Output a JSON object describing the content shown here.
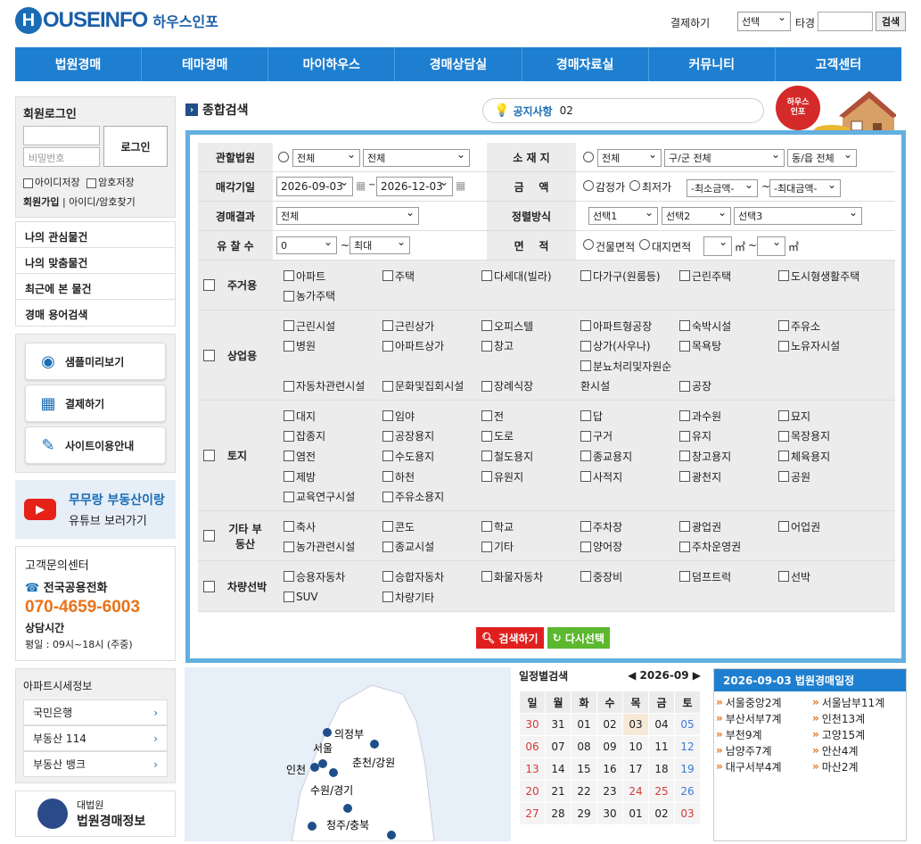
{
  "header": {
    "logo_letter": "H",
    "logo_text": "OUSEINFO",
    "logo_kr": "하우스인포",
    "pay": "결제하기",
    "select": "선택",
    "other": "타경",
    "search": "검색"
  },
  "nav": [
    "법원경매",
    "테마경매",
    "마이하우스",
    "경매상담실",
    "경매자료실",
    "커뮤니티",
    "고객센터"
  ],
  "login": {
    "title": "회원로그인",
    "pw": "비밀번호",
    "btn": "로그인",
    "save_id": "아이디저장",
    "save_pw": "암호저장",
    "join": "회원가입",
    "find": "아이디/암호찾기"
  },
  "menu": [
    "나의 관심물건",
    "나의 맞춤물건",
    "최근에 본 물건",
    "경매 용어검색"
  ],
  "quick": [
    {
      "icon": "eye-icon",
      "label": "샘플미리보기"
    },
    {
      "icon": "payment-icon",
      "label": "결제하기"
    },
    {
      "icon": "edit-icon",
      "label": "사이트이용안내"
    }
  ],
  "youtube": {
    "title": "무무랑 부동산이랑",
    "sub": "유튜브 보러가기"
  },
  "cs": {
    "title": "고객문의센터",
    "phone_label": "전국공용전화",
    "phone": "070-4659-6003",
    "hours_label": "상담시간",
    "hours": "평일 : 09시~18시 (주중)"
  },
  "apt": {
    "title": "아파트시세정보",
    "items": [
      "국민은행",
      "부동산 114",
      "부동산 뱅크"
    ]
  },
  "court": {
    "small": "대법원",
    "big": "법원경매정보"
  },
  "main": {
    "title": "종합검색",
    "notice_label": "공지사항",
    "notice_num": "02",
    "badge1": "하우스",
    "badge2": "인포"
  },
  "form": {
    "court": "관할법원",
    "all": "전체",
    "location": "소 재 지",
    "gu": "구/군 전체",
    "dong": "동/읍 전체",
    "date": "매각기일",
    "d1": "2026-09-03",
    "d2": "2026-12-03",
    "amount": "금    액",
    "appraise": "감정가",
    "minprice": "최저가",
    "minamt": "-최소금액-",
    "maxamt": "-최대금액-",
    "result": "경매결과",
    "sort": "정렬방식",
    "s1": "선택1",
    "s2": "선택2",
    "s3": "선택3",
    "fail": "유 찰 수",
    "fail_from": "0",
    "fail_to": "최대",
    "area": "면    적",
    "building": "건물면적",
    "land": "대지면적",
    "m2": "㎡"
  },
  "types": [
    {
      "label": "주거용",
      "items": [
        "아파트",
        "주택",
        "다세대(빌라)",
        "다가구(원룸등)",
        "근린주택",
        "도시형생활주택",
        "농가주택"
      ]
    },
    {
      "label": "상업용",
      "items": [
        "근린시설",
        "근린상가",
        "오피스텔",
        "아파트형공장",
        "숙박시설",
        "주유소",
        "병원",
        "아파트상가",
        "창고",
        "상가(사우나)",
        "목욕탕",
        "노유자시설",
        "",
        "",
        "",
        "분뇨처리및자원순",
        "",
        "",
        "자동차관련시설",
        "문화및집회시설",
        "장례식장",
        "환시설",
        "공장"
      ]
    },
    {
      "label": "토지",
      "items": [
        "대지",
        "임야",
        "전",
        "답",
        "과수원",
        "묘지",
        "잡종지",
        "공장용지",
        "도로",
        "구거",
        "유지",
        "목장용지",
        "염전",
        "수도용지",
        "철도용지",
        "종교용지",
        "창고용지",
        "체육용지",
        "제방",
        "하천",
        "유원지",
        "사적지",
        "광천지",
        "공원",
        "교육연구시설",
        "주유소용지"
      ]
    },
    {
      "label": "기타 부동산",
      "items": [
        "축사",
        "콘도",
        "학교",
        "주차장",
        "광업권",
        "어업권",
        "농가관련시설",
        "종교시설",
        "기타",
        "양어장",
        "주차운영권"
      ]
    },
    {
      "label": "차량선박",
      "items": [
        "승용자동차",
        "승합자동차",
        "화물자동차",
        "중장비",
        "덤프트럭",
        "선박",
        "SUV",
        "차량기타"
      ]
    }
  ],
  "buttons": {
    "search": "검색하기",
    "reset": "다시선택"
  },
  "map": [
    "의정부",
    "서울",
    "춘천/강원",
    "인천",
    "수원/경기",
    "청주/충북"
  ],
  "calendar": {
    "title": "일정별검색",
    "month": "2026-09",
    "weekdays": [
      "일",
      "월",
      "화",
      "수",
      "목",
      "금",
      "토"
    ],
    "rows": [
      [
        "30",
        "31",
        "01",
        "02",
        "03",
        "04",
        "05"
      ],
      [
        "06",
        "07",
        "08",
        "09",
        "10",
        "11",
        "12"
      ],
      [
        "13",
        "14",
        "15",
        "16",
        "17",
        "18",
        "19"
      ],
      [
        "20",
        "21",
        "22",
        "23",
        "24",
        "25",
        "26"
      ],
      [
        "27",
        "28",
        "29",
        "30",
        "01",
        "02",
        "03"
      ]
    ]
  },
  "schedule": {
    "title": "2026-09-03 법원경매일정",
    "items": [
      "서울중앙2계",
      "서울남부11계",
      "부산서부7계",
      "인천13계",
      "부천9계",
      "고양15계",
      "남양주7계",
      "안산4계",
      "대구서부4계",
      "마산2계"
    ]
  },
  "colors": {
    "nav": "#1e7fd0",
    "panel_border": "#62b0e0",
    "phone": "#e8731a",
    "search_btn": "#e0201f",
    "reset_btn": "#5cb82e"
  }
}
